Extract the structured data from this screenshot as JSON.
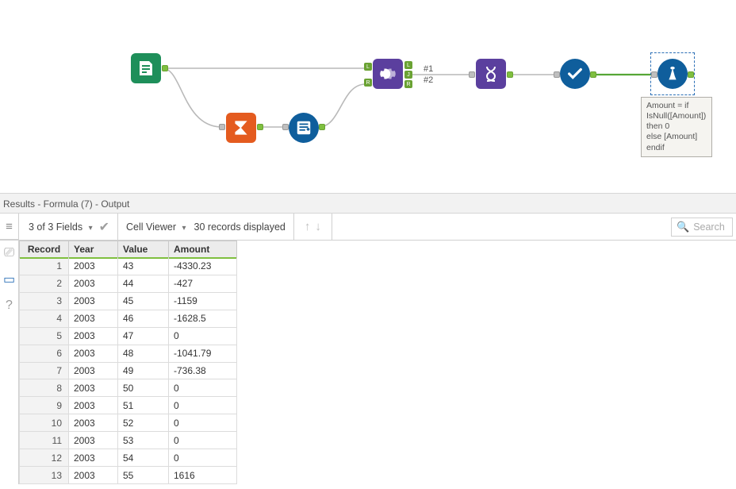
{
  "canvas": {
    "formula_annotation": {
      "l1": "Amount = if",
      "l2": "IsNull([Amount])",
      "l3": "then 0",
      "l4": "else [Amount]",
      "l5": "endif"
    },
    "hash1": "#1",
    "hash2": "#2"
  },
  "results": {
    "panel_title": "Results - Formula (7) - Output",
    "fields_label": "3 of 3 Fields",
    "cell_viewer": "Cell Viewer",
    "records_label": "30 records displayed",
    "search_placeholder": "Search",
    "columns": {
      "record": "Record",
      "year": "Year",
      "value": "Value",
      "amount": "Amount"
    },
    "rows": [
      {
        "n": "1",
        "year": "2003",
        "value": "43",
        "amount": "-4330.23"
      },
      {
        "n": "2",
        "year": "2003",
        "value": "44",
        "amount": "-427"
      },
      {
        "n": "3",
        "year": "2003",
        "value": "45",
        "amount": "-1159"
      },
      {
        "n": "4",
        "year": "2003",
        "value": "46",
        "amount": "-1628.5"
      },
      {
        "n": "5",
        "year": "2003",
        "value": "47",
        "amount": "0"
      },
      {
        "n": "6",
        "year": "2003",
        "value": "48",
        "amount": "-1041.79"
      },
      {
        "n": "7",
        "year": "2003",
        "value": "49",
        "amount": "-736.38"
      },
      {
        "n": "8",
        "year": "2003",
        "value": "50",
        "amount": "0"
      },
      {
        "n": "9",
        "year": "2003",
        "value": "51",
        "amount": "0"
      },
      {
        "n": "10",
        "year": "2003",
        "value": "52",
        "amount": "0"
      },
      {
        "n": "11",
        "year": "2003",
        "value": "53",
        "amount": "0"
      },
      {
        "n": "12",
        "year": "2003",
        "value": "54",
        "amount": "0"
      },
      {
        "n": "13",
        "year": "2003",
        "value": "55",
        "amount": "1616"
      }
    ]
  }
}
